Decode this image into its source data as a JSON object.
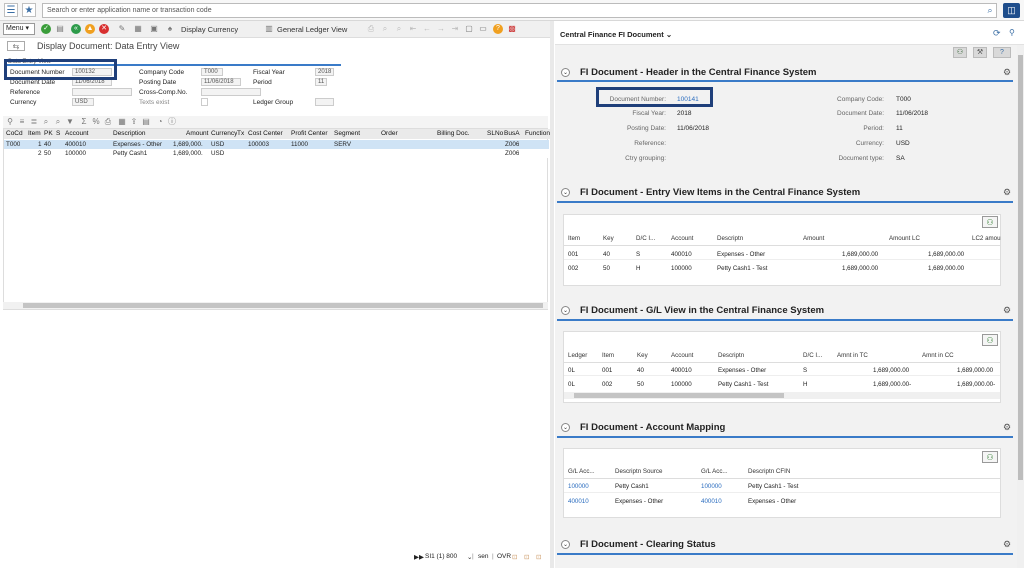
{
  "shell": {
    "search_placeholder": "Search or enter application name or transaction code"
  },
  "left": {
    "toolbar": {
      "menu_label": "Menu",
      "display_currency": "Display Currency",
      "general_ledger_view": "General Ledger View"
    },
    "page_title": "Display Document: Data Entry View",
    "header_section_title": "Data Entry View",
    "fields": {
      "doc_number_label": "Document Number",
      "doc_number_value": "100132",
      "company_code_label": "Company Code",
      "company_code_value": "T000",
      "fiscal_year_label": "Fiscal Year",
      "fiscal_year_value": "2018",
      "doc_date_label": "Document Date",
      "doc_date_value": "11/06/2018",
      "posting_date_label": "Posting Date",
      "posting_date_value": "11/06/2018",
      "period_label": "Period",
      "period_value": "11",
      "reference_label": "Reference",
      "cross_comp_label": "Cross-Comp.No.",
      "currency_label": "Currency",
      "currency_value": "USD",
      "texts_exist_label": "Texts exist",
      "ledger_group_label": "Ledger Group"
    },
    "grid": {
      "headers": [
        "CoCd",
        "Item",
        "PK",
        "S",
        "Account",
        "Description",
        "Amount",
        "Currency",
        "Tx",
        "Cost Center",
        "Profit Center",
        "Segment",
        "Order",
        "Billing Doc.",
        "SLNo",
        "BusA",
        "Function"
      ],
      "rows": [
        {
          "cocd": "T000",
          "item": "1",
          "pk": "40",
          "s": "",
          "account": "400010",
          "desc": "Expenses - Other",
          "amount": "1,689,000.",
          "curr": "USD",
          "cost_center": "100003",
          "profit_center": "11000",
          "segment": "SERV",
          "busa": "Z006"
        },
        {
          "cocd": "",
          "item": "2",
          "pk": "50",
          "s": "",
          "account": "100000",
          "desc": "Petty Cash1",
          "amount": "1,689,000.",
          "curr": "USD",
          "cost_center": "",
          "profit_center": "",
          "segment": "",
          "busa": "Z006"
        }
      ]
    },
    "status": {
      "system": "SI1 (1) 800",
      "user": "sen",
      "mode": "OVR"
    }
  },
  "right": {
    "panel_title": "Central Finance FI Document",
    "header_section": {
      "title": "FI Document - Header in the Central Finance System",
      "doc_number_label": "Document Number:",
      "doc_number_value": "100141",
      "fiscal_year_label": "Fiscal Year:",
      "fiscal_year_value": "2018",
      "posting_date_label": "Posting Date:",
      "posting_date_value": "11/06/2018",
      "reference_label": "Reference:",
      "ctry_grouping_label": "Ctry grouping:",
      "company_code_label": "Company Code:",
      "company_code_value": "T000",
      "document_date_label": "Document Date:",
      "document_date_value": "11/06/2018",
      "period_label": "Period:",
      "period_value": "11",
      "currency_label": "Currency:",
      "currency_value": "USD",
      "document_type_label": "Document type:",
      "document_type_value": "SA"
    },
    "entry_view": {
      "title": "FI Document - Entry View Items in the Central Finance System",
      "headers": [
        "Item",
        "Key",
        "D/C I...",
        "Account",
        "Descriptn",
        "Amount",
        "Amount LC",
        "LC2 amou"
      ],
      "rows": [
        [
          "001",
          "40",
          "S",
          "400010",
          "Expenses - Other",
          "1,689,000.00",
          "1,689,000.00"
        ],
        [
          "002",
          "50",
          "H",
          "100000",
          "Petty Cash1 - Test",
          "1,689,000.00",
          "1,689,000.00"
        ]
      ]
    },
    "gl_view": {
      "title": "FI Document - G/L View in the Central Finance System",
      "headers": [
        "Ledger",
        "Item",
        "Key",
        "Account",
        "Descriptn",
        "D/C I...",
        "Amnt in TC",
        "Amnt in CC"
      ],
      "rows": [
        [
          "0L",
          "001",
          "40",
          "400010",
          "Expenses - Other",
          "S",
          "1,689,000.00",
          "1,689,000.00"
        ],
        [
          "0L",
          "002",
          "50",
          "100000",
          "Petty Cash1 - Test",
          "H",
          "1,689,000.00-",
          "1,689,000.00-"
        ]
      ]
    },
    "account_mapping": {
      "title": "FI Document - Account Mapping",
      "headers": [
        "G/L Acc...",
        "Descriptn Source",
        "G/L Acc...",
        "Descriptn CFIN"
      ],
      "rows": [
        [
          "100000",
          "Petty Cash1",
          "100000",
          "Petty Cash1 - Test"
        ],
        [
          "400010",
          "Expenses - Other",
          "400010",
          "Expenses - Other"
        ]
      ]
    },
    "clearing_status": {
      "title": "FI Document - Clearing Status"
    }
  }
}
